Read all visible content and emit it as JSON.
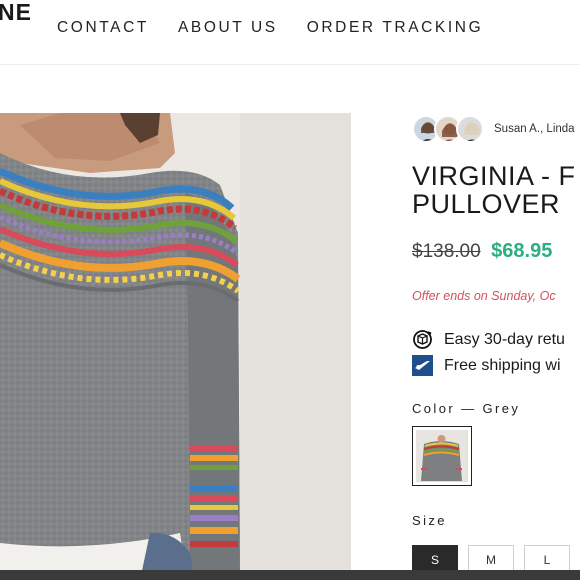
{
  "header": {
    "logo_text": "NE",
    "nav": [
      "CONTACT",
      "ABOUT US",
      "ORDER TRACKING"
    ]
  },
  "product": {
    "reviewers": "Susan A., Linda",
    "title_line1": "VIRGINIA - F",
    "title_line2": "PULLOVER",
    "price_old": "$138.00",
    "price_new": "$68.95",
    "offer_text": "Offer ends on Sunday, Oc",
    "perk_returns": "Easy 30-day retu",
    "perk_shipping": "Free shipping wi",
    "color_label": "Color — Grey",
    "size_label": "Size",
    "sizes": [
      "S",
      "M",
      "L"
    ],
    "selected_size": "S"
  },
  "colors": {
    "accent_price": "#2baf7f",
    "offer": "#d2515b",
    "usps_blue": "#1f4e8c"
  }
}
